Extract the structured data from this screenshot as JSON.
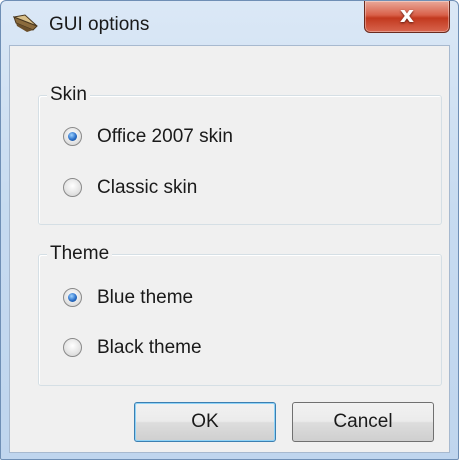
{
  "window": {
    "title": "GUI options",
    "close_glyph": "x",
    "icon": "application-icon"
  },
  "skin_group": {
    "legend": "Skin",
    "options": [
      {
        "label": "Office 2007 skin",
        "checked": true
      },
      {
        "label": "Classic skin",
        "checked": false
      }
    ]
  },
  "theme_group": {
    "legend": "Theme",
    "options": [
      {
        "label": "Blue theme",
        "checked": true
      },
      {
        "label": "Black theme",
        "checked": false
      }
    ]
  },
  "buttons": {
    "ok_label": "OK",
    "cancel_label": "Cancel"
  },
  "colors": {
    "accent": "#2a6fc9",
    "close_red": "#c2391f"
  }
}
